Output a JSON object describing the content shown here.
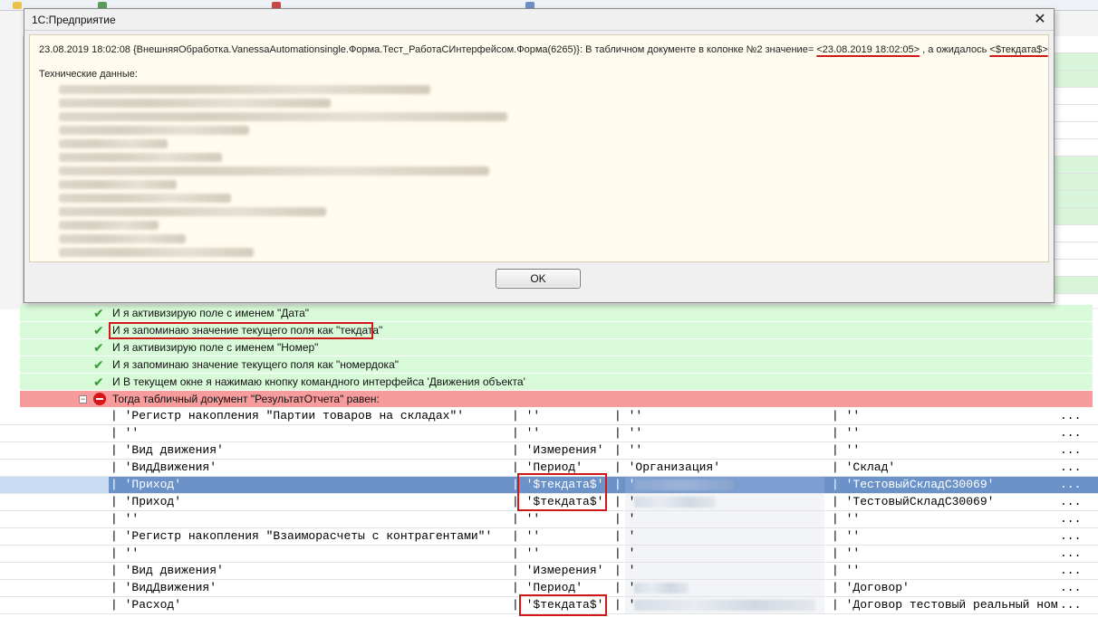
{
  "dialog": {
    "title": "1С:Предприятие",
    "close_label": "✕",
    "message_prefix": "23.08.2019 18:02:08 {ВнешняяОбработка.VanessaAutomationsingle.Форма.Тест_РаботаСИнтерфейсом.Форма(6265)}: В табличном документе в колонке №2 значение= ",
    "actual_value": "<23.08.2019 18:02:05>",
    "message_mid": " , а ожидалось ",
    "expected_value": "<$текдата$>",
    "tech_label": "Технические данные:",
    "ok_label": "OK"
  },
  "steps": [
    {
      "text": "И я активизирую поле с именем \"Дата\"",
      "status": "passed"
    },
    {
      "text": "И я запоминаю значение текущего поля как \"текдата\"",
      "status": "passed"
    },
    {
      "text": "И я активизирую поле с именем \"Номер\"",
      "status": "passed"
    },
    {
      "text": "И я запоминаю значение текущего поля как \"номердока\"",
      "status": "passed"
    },
    {
      "text": "И В текущем окне я нажимаю кнопку командного интерфейса 'Движения объекта'",
      "status": "passed"
    },
    {
      "text": "Тогда табличный документ \"РезультатОтчета\" равен:",
      "status": "failed"
    }
  ],
  "table": {
    "rows": [
      {
        "c0": "| 'Регистр накопления \"Партии товаров на складах\"'",
        "c1": "| ''",
        "c2": "| ''",
        "c3": "| ''",
        "ell": "..."
      },
      {
        "c0": "| ''",
        "c1": "| ''",
        "c2": "| ''",
        "c3": "| ''",
        "ell": "..."
      },
      {
        "c0": "| 'Вид движения'",
        "c1": "| 'Измерения'",
        "c2": "| ''",
        "c3": "| ''",
        "ell": "..."
      },
      {
        "c0": "| 'ВидДвижения'",
        "c1": "| 'Период'",
        "c2": "| 'Организация'",
        "c3": "| 'Склад'",
        "ell": "..."
      },
      {
        "c0": "| 'Приход'",
        "c1": "| '$текдата$'",
        "c2": "| '",
        "c3": "| 'ТестовыйСкладС30069'",
        "ell": "...",
        "selected": true
      },
      {
        "c0": "| 'Приход'",
        "c1": "| '$текдата$'",
        "c2": "| '",
        "c3": "| 'ТестовыйСкладС30069'",
        "ell": "..."
      },
      {
        "c0": "| ''",
        "c1": "| ''",
        "c2": "| '",
        "c3": "| ''",
        "ell": "..."
      },
      {
        "c0": "| 'Регистр накопления \"Взаиморасчеты с контрагентами\"'",
        "c1": "| ''",
        "c2": "| '",
        "c3": "| ''",
        "ell": "..."
      },
      {
        "c0": "| ''",
        "c1": "| ''",
        "c2": "| '",
        "c3": "| ''",
        "ell": "..."
      },
      {
        "c0": "| 'Вид движения'",
        "c1": "| 'Измерения'",
        "c2": "| '",
        "c3": "| ''",
        "ell": "..."
      },
      {
        "c0": "| 'ВидДвижения'",
        "c1": "| 'Период'",
        "c2": "| '",
        "c3": "| 'Договор'",
        "ell": "..."
      },
      {
        "c0": "| 'Расход'",
        "c1": "| '$текдата$'",
        "c2": "| '",
        "c3": "| 'Договор тестовый реальный ном",
        "ell": "..."
      }
    ]
  },
  "colors": {
    "passed": "#d9fad9",
    "failed": "#f79c9c",
    "selected_row": "#6b92c9",
    "highlight": "#d01818"
  }
}
